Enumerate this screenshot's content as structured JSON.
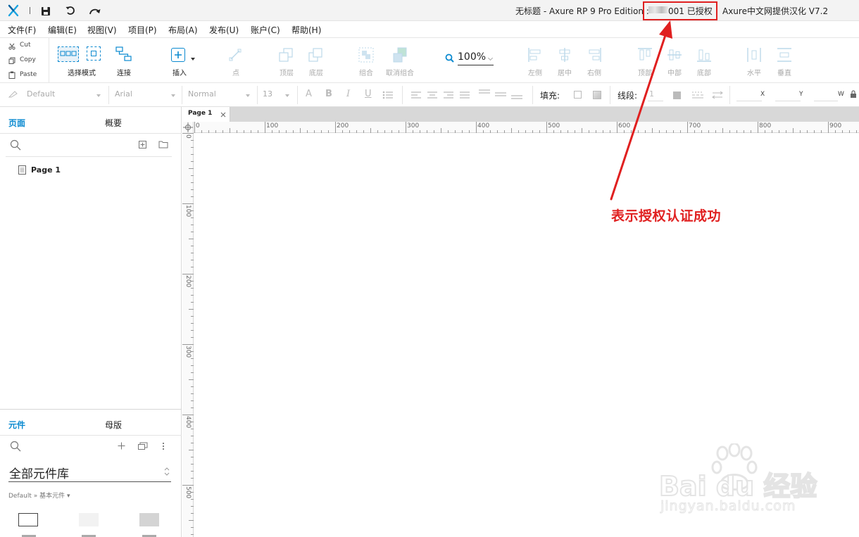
{
  "titlebar": {
    "title_left": "无标题 - Axure RP 9 Pro Edition : ",
    "license": "001 已授权",
    "title_right": "Axure中文网提供汉化 V7.2"
  },
  "menu": [
    "文件(F)",
    "编辑(E)",
    "视图(V)",
    "项目(P)",
    "布局(A)",
    "发布(U)",
    "账户(C)",
    "帮助(H)"
  ],
  "edit": {
    "cut": "Cut",
    "copy": "Copy",
    "paste": "Paste"
  },
  "toolbar": {
    "select_mode": "选择模式",
    "connect": "连接",
    "insert": "插入",
    "point": "点",
    "top_layer": "顶层",
    "bottom_layer": "底层",
    "group": "组合",
    "ungroup": "取消组合",
    "zoom": "100%",
    "align_left": "左侧",
    "align_center": "居中",
    "align_right": "右侧",
    "align_top": "顶部",
    "align_middle": "中部",
    "align_bottom": "底部",
    "distribute_h": "水平",
    "distribute_v": "垂直"
  },
  "stylebar": {
    "style": "Default",
    "font": "Arial",
    "weight": "Normal",
    "size": "13",
    "fill_label": "填充:",
    "line_label": "线段:",
    "line_value": "1",
    "x_label": "X",
    "y_label": "Y",
    "w_label": "W"
  },
  "left_panel": {
    "tab_pages": "页面",
    "tab_outline": "概要",
    "page_item": "Page 1",
    "tab_widgets": "元件",
    "tab_masters": "母版",
    "library": "全部元件库",
    "breadcrumb": "Default » 基本元件 ▾"
  },
  "canvas": {
    "page_tab": "Page 1",
    "ruler_h": [
      "0",
      "100",
      "200",
      "300",
      "400",
      "500",
      "600",
      "700",
      "800",
      "900"
    ],
    "ruler_v": [
      "0",
      "100",
      "200",
      "300",
      "400",
      "500"
    ]
  },
  "annotation": {
    "text": "表示授权认证成功"
  },
  "watermark": {
    "brand": "Bai du 经验",
    "url": "jingyan.baidu.com"
  },
  "colors": {
    "accent": "#0b8ad0",
    "annotation": "#e02020"
  }
}
